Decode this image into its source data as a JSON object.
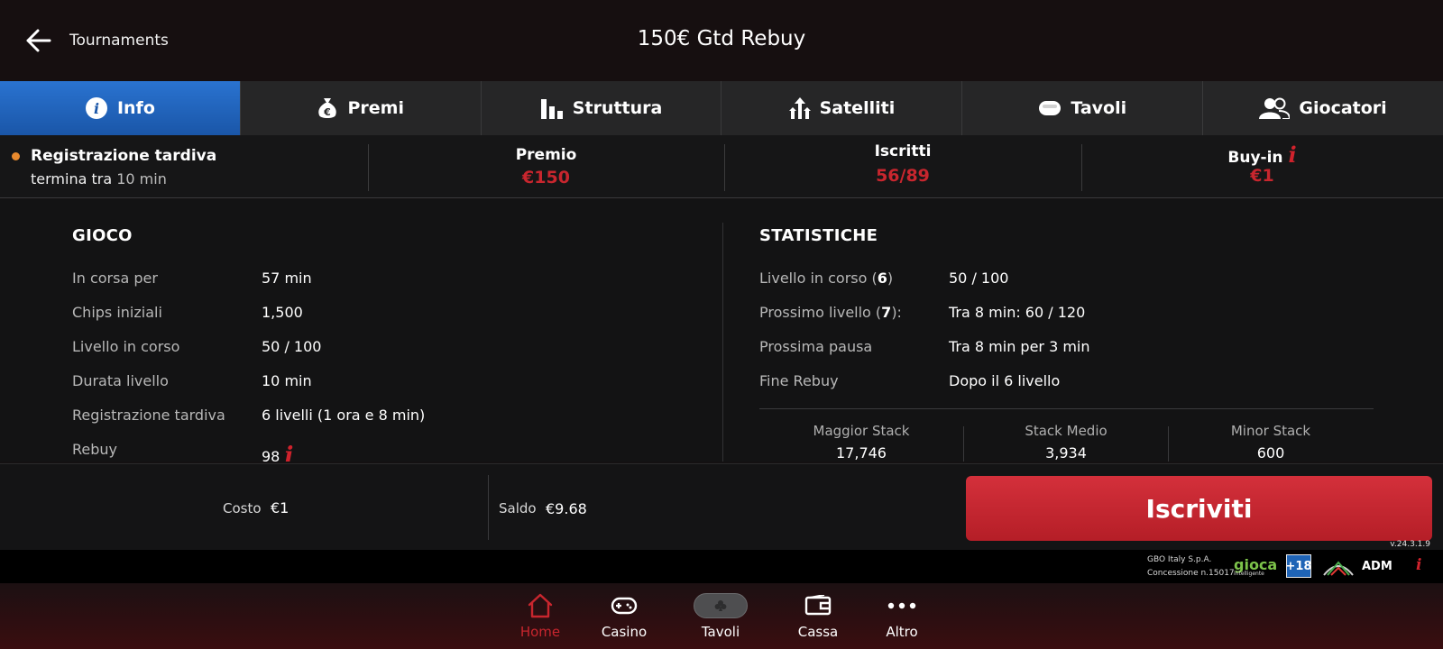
{
  "header": {
    "back_label": "Tournaments",
    "title": "150€ Gtd Rebuy"
  },
  "tabs": [
    {
      "label": "Info",
      "icon": "info-icon",
      "active": true
    },
    {
      "label": "Premi",
      "icon": "money-bag-icon",
      "active": false
    },
    {
      "label": "Struttura",
      "icon": "bar-chart-icon",
      "active": false
    },
    {
      "label": "Satelliti",
      "icon": "satellite-arrows-icon",
      "active": false
    },
    {
      "label": "Tavoli",
      "icon": "table-icon",
      "active": false
    },
    {
      "label": "Giocatori",
      "icon": "players-icon",
      "active": false
    }
  ],
  "summary": {
    "late_reg_title": "Registrazione tardiva",
    "late_reg_prefix": "termina tra",
    "late_reg_time": "10 min",
    "premio_label": "Premio",
    "premio_value": "€150",
    "iscritti_label": "Iscritti",
    "iscritti_value": "56/89",
    "buyin_label": "Buy-in",
    "buyin_value": "€1",
    "info_glyph": "i"
  },
  "gioco": {
    "title": "GIOCO",
    "rows": [
      {
        "label": "In corsa per",
        "value": "57 min"
      },
      {
        "label": "Chips iniziali",
        "value": "1,500"
      },
      {
        "label": "Livello in corso",
        "value": "50 / 100"
      },
      {
        "label": "Durata livello",
        "value": "10 min"
      },
      {
        "label": "Registrazione tardiva",
        "value": "6 livelli (1 ora e 8 min)"
      },
      {
        "label": "Rebuy",
        "value": "98"
      }
    ]
  },
  "statistiche": {
    "title": "STATISTICHE",
    "rows": [
      {
        "label_pre": "Livello in corso (",
        "label_bold": "6",
        "label_post": ")",
        "value": "50 / 100"
      },
      {
        "label_pre": "Prossimo livello (",
        "label_bold": "7",
        "label_post": "):",
        "value": "Tra 8 min: 60 / 120"
      },
      {
        "label_pre": "Prossima pausa",
        "label_bold": "",
        "label_post": "",
        "value": "Tra 8 min per 3 min"
      },
      {
        "label_pre": "Fine Rebuy",
        "label_bold": "",
        "label_post": "",
        "value": "Dopo il 6 livello"
      }
    ],
    "stacks": [
      {
        "label": "Maggior Stack",
        "value": "17,746"
      },
      {
        "label": "Stack Medio",
        "value": "3,934"
      },
      {
        "label": "Minor Stack",
        "value": "600"
      }
    ]
  },
  "action": {
    "cost_label": "Costo",
    "cost_value": "€1",
    "saldo_label": "Saldo",
    "saldo_value": "€9.68",
    "button_label": "Iscriviti",
    "version": "v.24.3.1.9"
  },
  "legal": {
    "company": "GBO Italy S.p.A.",
    "concession": "Concessione n.15017",
    "gioca_text": "gioca",
    "gioca_sub": "intelligente",
    "age_badge": "+18",
    "adm_text": "ADM"
  },
  "bottom_nav": [
    {
      "label": "Home",
      "icon": "home-icon",
      "active": true
    },
    {
      "label": "Casino",
      "icon": "gamepad-icon",
      "active": false
    },
    {
      "label": "Tavoli",
      "icon": "club-icon",
      "active": false
    },
    {
      "label": "Cassa",
      "icon": "wallet-icon",
      "active": false
    },
    {
      "label": "Altro",
      "icon": "more-icon",
      "active": false
    }
  ],
  "colors": {
    "accent_red": "#c8262e",
    "tab_active_blue": "#2a73d0",
    "late_reg_dot": "#e98a2e"
  }
}
